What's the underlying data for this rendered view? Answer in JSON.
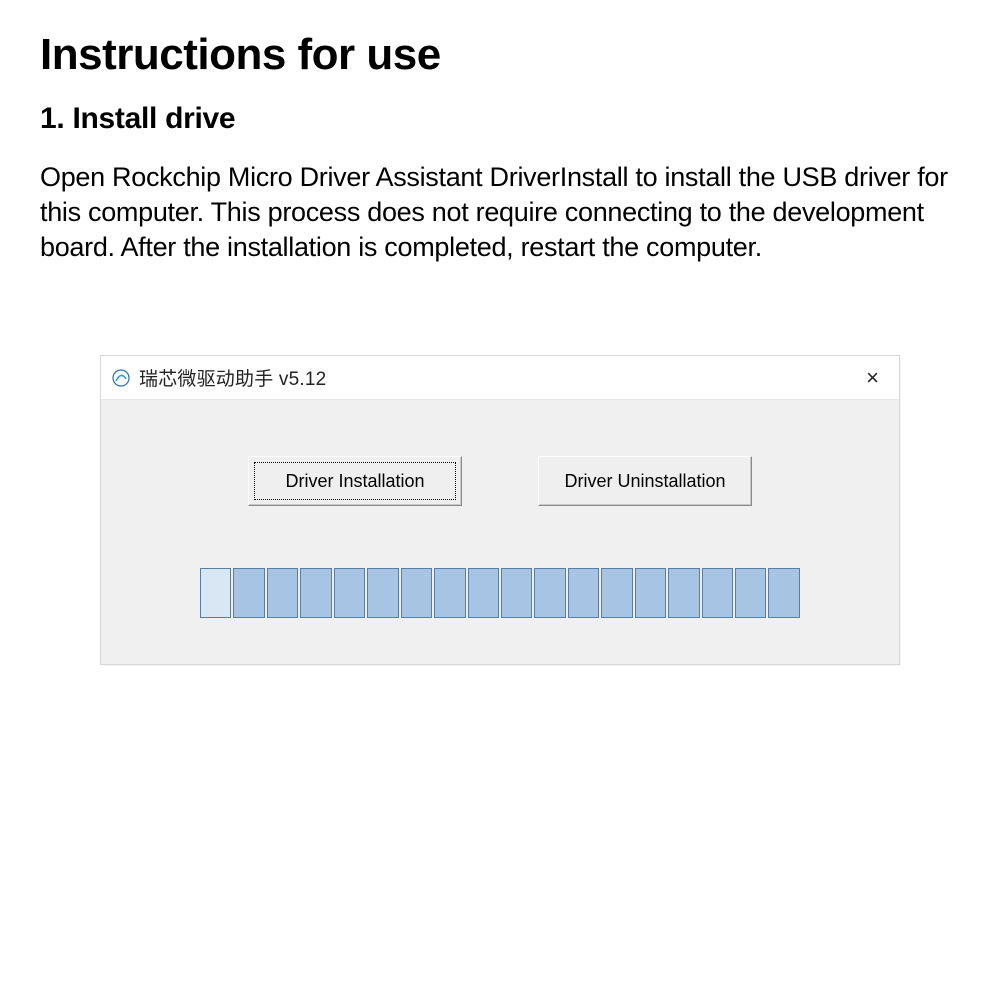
{
  "heading": "Instructions for use",
  "section": "1. Install drive",
  "paragraph": "Open Rockchip Micro Driver Assistant DriverInstall to install the USB driver for this computer. This process does not require connecting to the development board. After the installation is completed, restart the computer.",
  "dialog": {
    "title": "瑞芯微驱动助手 v5.12",
    "close": "×",
    "install_label": "Driver Installation",
    "uninstall_label": "Driver Uninstallation",
    "progress_segments": 18
  }
}
